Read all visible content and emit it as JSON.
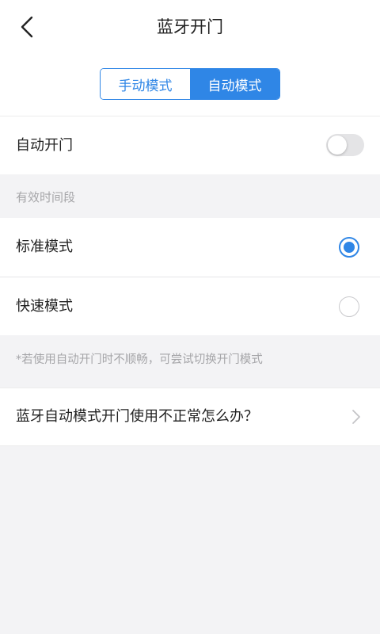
{
  "header": {
    "title": "蓝牙开门",
    "back_icon": "chevron-left-icon"
  },
  "mode_switch": {
    "options": [
      "手动模式",
      "自动模式"
    ],
    "selected": "自动模式"
  },
  "auto_open": {
    "label": "自动开门",
    "enabled": false
  },
  "valid_period": {
    "caption": "有效时间段",
    "options": [
      {
        "label": "标准模式",
        "selected": true
      },
      {
        "label": "快速模式",
        "selected": false
      }
    ]
  },
  "hint": "*若使用自动开门时不顺畅，可尝试切换开门模式",
  "help_link": {
    "label": "蓝牙自动模式开门使用不正常怎么办？"
  },
  "colors": {
    "accent": "#2f86e6",
    "background": "#f3f3f5",
    "caption_text": "#a5a5a8"
  }
}
